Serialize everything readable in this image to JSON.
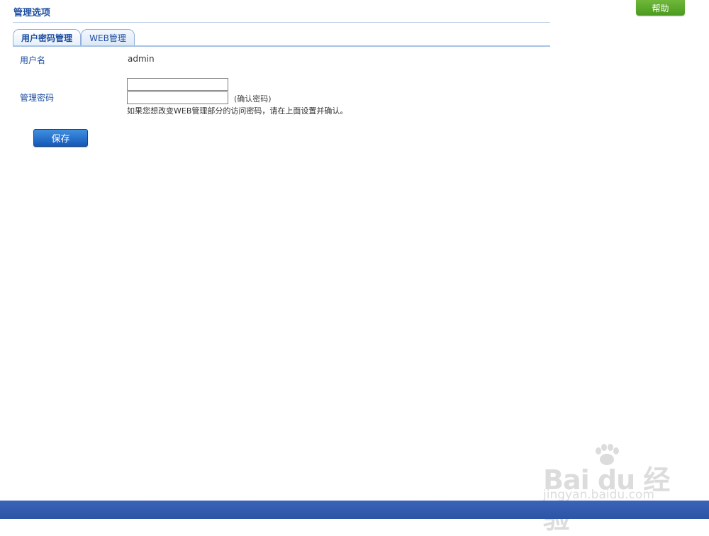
{
  "header": {
    "title": "管理选项",
    "help_label": "帮助"
  },
  "tabs": [
    {
      "label": "用户密码管理",
      "active": true
    },
    {
      "label": "WEB管理",
      "active": false
    }
  ],
  "form": {
    "username_label": "用户名",
    "username_value": "admin",
    "password_label": "管理密码",
    "password_value": "",
    "confirm_value": "",
    "confirm_note": "(确认密码)",
    "hint": "如果您想改变WEB管理部分的访问密码，请在上面设置并确认。",
    "save_label": "保存"
  },
  "watermark": {
    "brand": "Bai du 经验",
    "url": "jingyan.baidu.com"
  },
  "colors": {
    "accent": "#1f4fa0",
    "help": "#5aa62a",
    "footer": "#3459ad"
  }
}
